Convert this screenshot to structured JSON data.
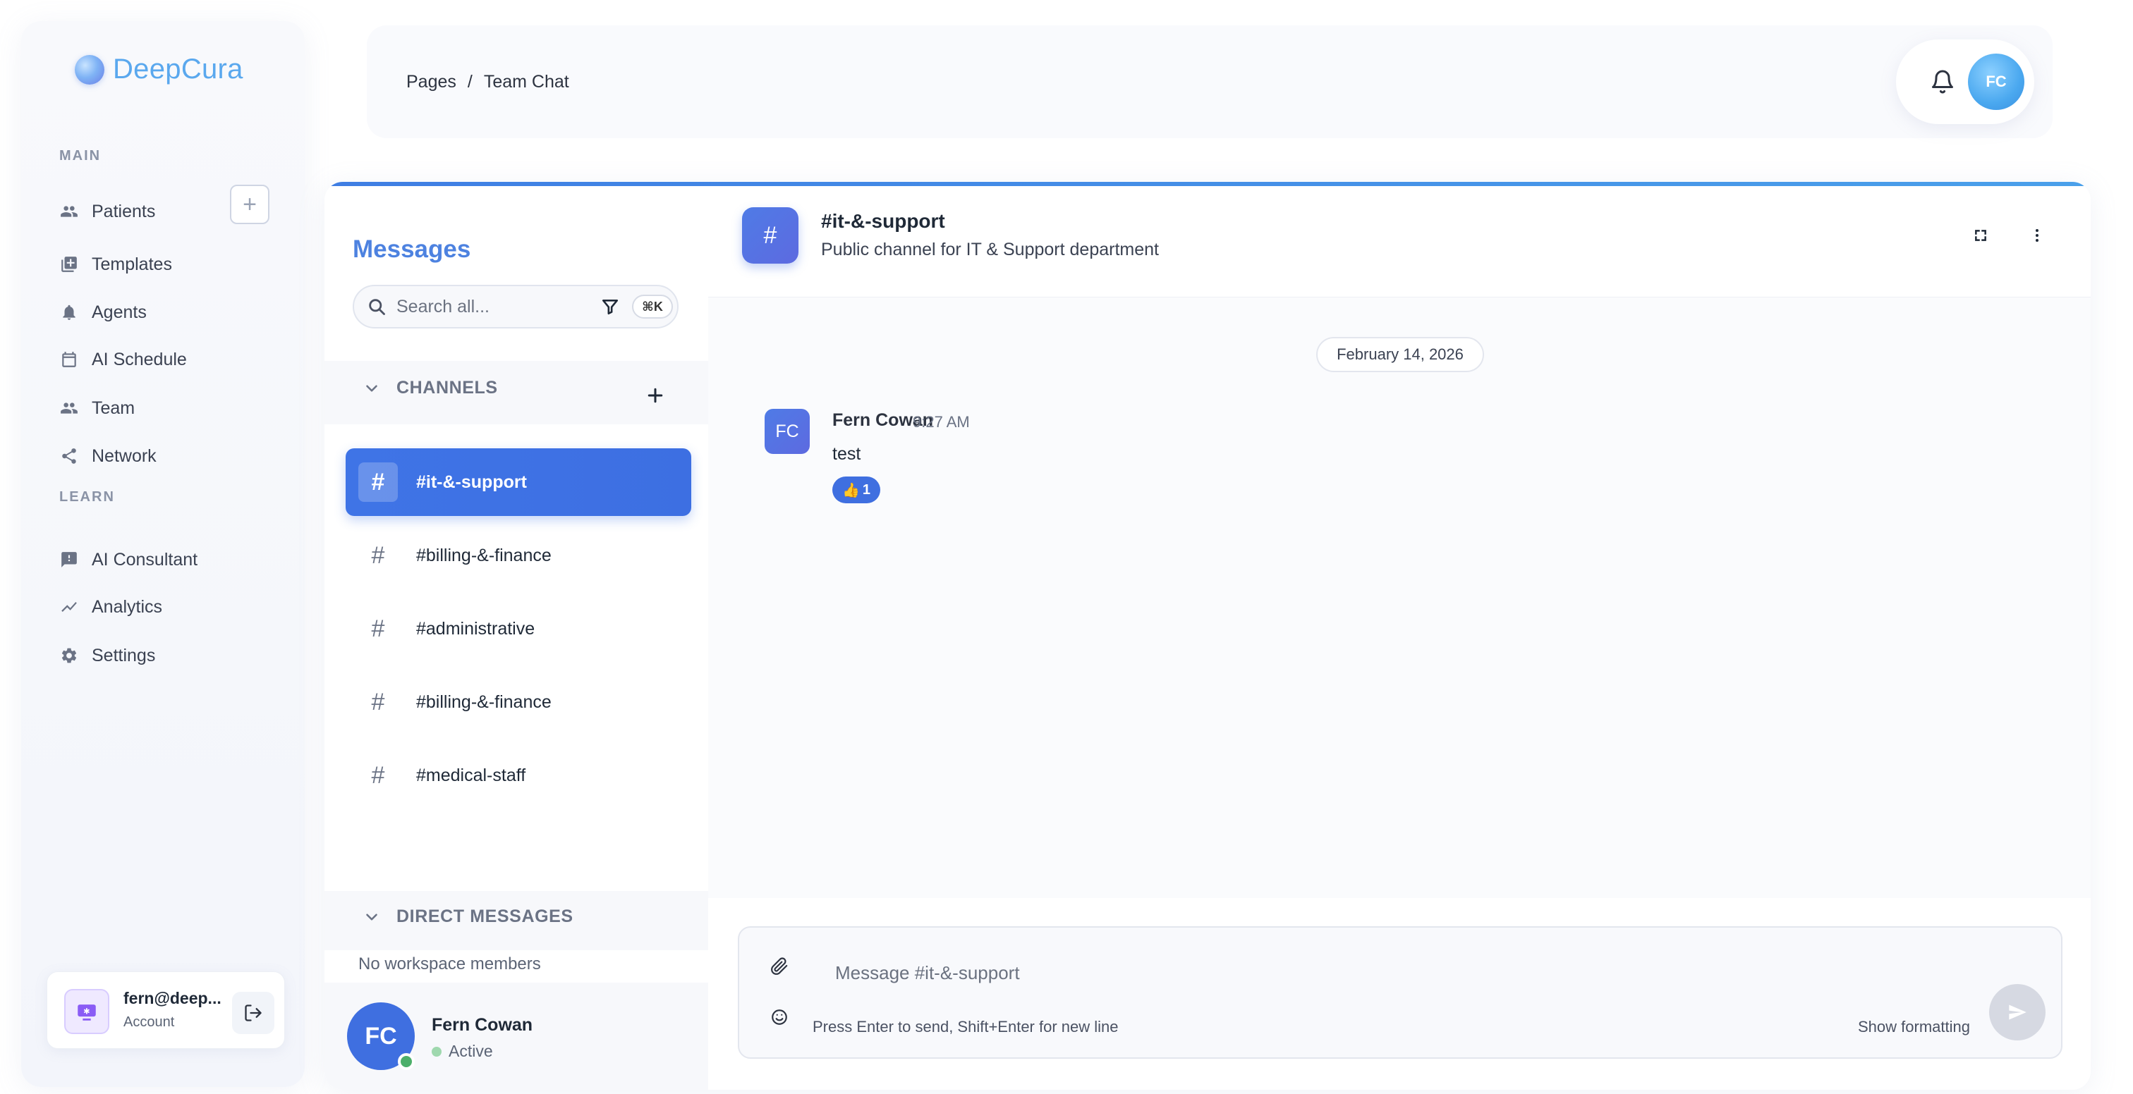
{
  "app": {
    "name": "DeepCura"
  },
  "sidebar": {
    "sections": [
      {
        "label": "MAIN"
      },
      {
        "label": "LEARN"
      }
    ],
    "items": [
      {
        "label": "Patients",
        "icon": "people-icon"
      },
      {
        "label": "Templates",
        "icon": "library-add-icon"
      },
      {
        "label": "Agents",
        "icon": "bell-alert-icon"
      },
      {
        "label": "AI Schedule",
        "icon": "calendar-icon"
      },
      {
        "label": "Team",
        "icon": "people-icon"
      },
      {
        "label": "Network",
        "icon": "share-icon"
      },
      {
        "label": "AI Consultant",
        "icon": "feedback-icon"
      },
      {
        "label": "Analytics",
        "icon": "trending-line-icon"
      },
      {
        "label": "Settings",
        "icon": "gear-icon"
      }
    ],
    "account": {
      "email": "fern@deep...",
      "subtitle": "Account"
    }
  },
  "header": {
    "breadcrumb": [
      "Pages",
      "/",
      "Team Chat"
    ],
    "avatar_initials": "FC"
  },
  "messages_panel": {
    "title": "Messages",
    "search_placeholder": "Search all...",
    "shortcut": "⌘K",
    "channels_label": "CHANNELS",
    "channels": [
      {
        "name": "#it-&-support",
        "active": true
      },
      {
        "name": "#billing-&-finance",
        "active": false
      },
      {
        "name": "#administrative",
        "active": false
      },
      {
        "name": "#billing-&-finance",
        "active": false
      },
      {
        "name": "#medical-staff",
        "active": false
      }
    ],
    "dm_label": "DIRECT MESSAGES",
    "dm_empty": "No workspace members",
    "me": {
      "initials": "FC",
      "name": "Fern Cowan",
      "status": "Active"
    }
  },
  "conversation": {
    "channel_icon": "#",
    "channel_name": "#it-&-support",
    "channel_description": "Public channel for IT & Support department",
    "date_divider": "February 14, 2026",
    "messages": [
      {
        "initials": "FC",
        "author": "Fern Cowan",
        "time": "9:27 AM",
        "text": "test",
        "reaction": {
          "emoji": "👍",
          "count": "1"
        }
      }
    ],
    "composer": {
      "placeholder": "Message #it-&-support",
      "hint": "Press Enter to send, Shift+Enter for new line",
      "show_formatting": "Show formatting"
    }
  },
  "colors": {
    "accent": "#3f6fe0",
    "brand": "#5aa8ee",
    "status_active": "#4caf6a"
  }
}
